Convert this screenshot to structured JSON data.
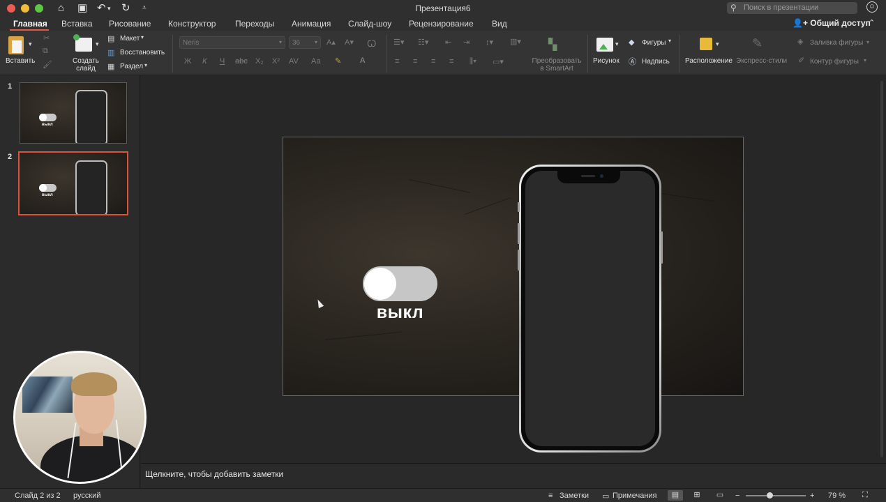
{
  "window": {
    "title": "Презентация6",
    "search_placeholder": "Поиск в презентации",
    "colors": {
      "accent": "#e05a3c",
      "close": "#ee5b53",
      "minimize": "#f2bc3b",
      "maximize": "#5fc644"
    }
  },
  "tabs": [
    "Главная",
    "Вставка",
    "Рисование",
    "Конструктор",
    "Переходы",
    "Анимация",
    "Слайд-шоу",
    "Рецензирование",
    "Вид"
  ],
  "active_tab": "Главная",
  "share_label": "Общий доступ",
  "ribbon": {
    "paste": "Вставить",
    "new_slide_line1": "Создать",
    "new_slide_line2": "слайд",
    "layout": "Макет",
    "reset": "Восстановить",
    "section": "Раздел",
    "font_name": "Neris",
    "font_size": "36",
    "bold": "Ж",
    "italic": "К",
    "underline": "Ч",
    "strike": "abc",
    "subscript": "X₂",
    "superscript": "X²",
    "spacing": "AV",
    "case": "Aa",
    "smartart_line1": "Преобразовать",
    "smartart_line2": "в SmartArt",
    "picture": "Рисунок",
    "shapes": "Фигуры",
    "textbox": "Надпись",
    "arrange": "Расположение",
    "quick_styles": "Экспресс-стили",
    "shape_fill": "Заливка фигуры",
    "shape_outline": "Контур фигуры"
  },
  "thumbnails": [
    {
      "number": "1",
      "label": "выкл"
    },
    {
      "number": "2",
      "label": "выкл"
    }
  ],
  "slide": {
    "toggle_label": "выкл"
  },
  "notes_placeholder": "Щелкните, чтобы добавить заметки",
  "status": {
    "slide_position": "Слайд 2 из 2",
    "language": "русский",
    "notes": "Заметки",
    "comments": "Примечания",
    "zoom_minus": "−",
    "zoom_plus": "+",
    "zoom_value": "79 %",
    "zoom_fraction": 0.79
  }
}
